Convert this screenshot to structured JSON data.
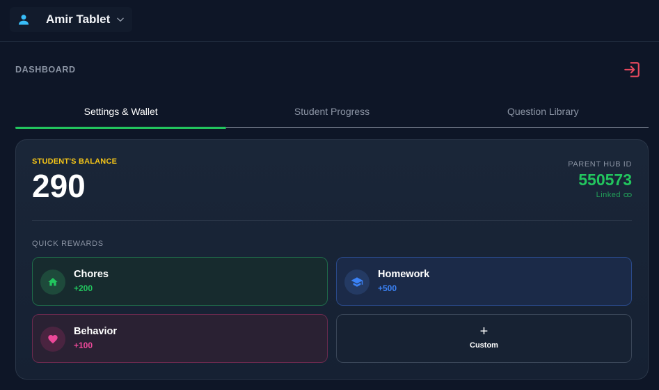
{
  "device": {
    "name": "Amir Tablet",
    "icon": "person-icon"
  },
  "header": {
    "title": "DASHBOARD",
    "logout_icon": "logout-icon"
  },
  "tabs": [
    {
      "label": "Settings & Wallet",
      "active": true
    },
    {
      "label": "Student Progress",
      "active": false
    },
    {
      "label": "Question Library",
      "active": false
    }
  ],
  "wallet": {
    "balance_label": "STUDENT'S BALANCE",
    "balance_value": "290",
    "hub_label": "PARENT HUB ID",
    "hub_id": "550573",
    "linked_label": "Linked"
  },
  "quick_rewards": {
    "label": "QUICK REWARDS",
    "items": [
      {
        "title": "Chores",
        "amount": "+200",
        "icon": "home-icon",
        "color": "#22c55e"
      },
      {
        "title": "Homework",
        "amount": "+500",
        "icon": "graduation-cap-icon",
        "color": "#3b82f6"
      },
      {
        "title": "Behavior",
        "amount": "+100",
        "icon": "heart-icon",
        "color": "#ec4899"
      }
    ],
    "custom": {
      "plus": "+",
      "label": "Custom"
    }
  },
  "colors": {
    "accent_green": "#22c55e",
    "balance_label": "#f5c518",
    "logout": "#e5485d",
    "person_icon": "#38bdf8"
  }
}
